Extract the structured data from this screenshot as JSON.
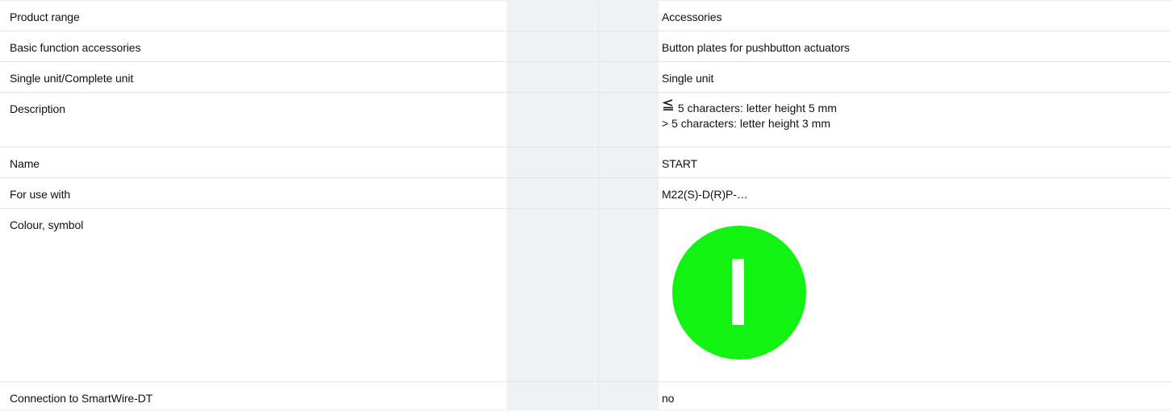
{
  "rows": [
    {
      "label": "Product range",
      "value": "Accessories"
    },
    {
      "label": "Basic function accessories",
      "value": "Button plates for pushbutton actuators"
    },
    {
      "label": "Single unit/Complete unit",
      "value": "Single unit"
    },
    {
      "label": "Description",
      "value_lines": [
        "5 characters: letter height 5 mm",
        "> 5 characters: letter height 3 mm"
      ],
      "value_icon": "less-than-or-equal-icon"
    },
    {
      "label": "Name",
      "value": "START"
    },
    {
      "label": "For use with",
      "value": "M22(S)-D(R)P-…"
    },
    {
      "label": "Colour, symbol",
      "value_symbol": {
        "icon": "start-symbol-icon",
        "fill_color": "#13f313",
        "mark_color": "#ffffff"
      }
    },
    {
      "label": "Connection to SmartWire-DT",
      "value": "no"
    }
  ],
  "colors": {
    "gap_column": "#eff1f4",
    "row_border": "#e3e5e8"
  }
}
